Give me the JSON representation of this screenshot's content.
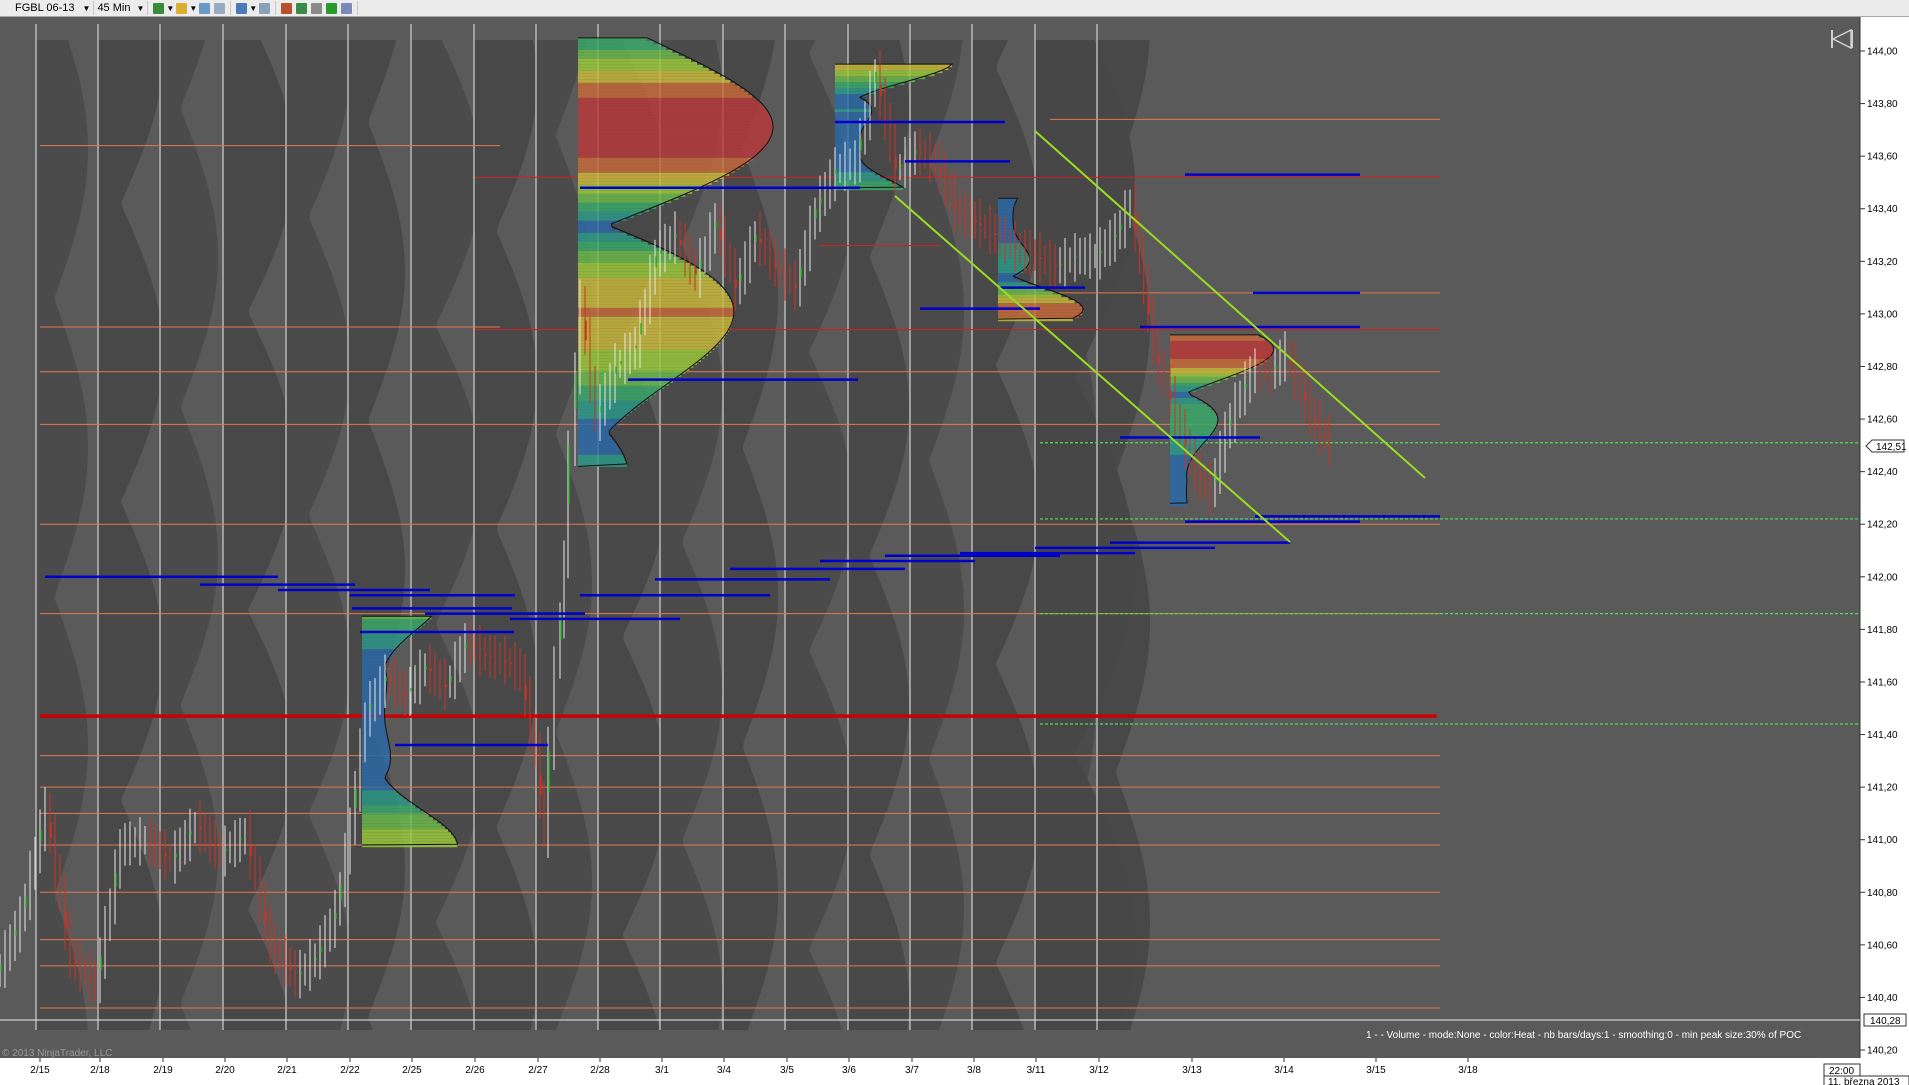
{
  "toolbar": {
    "instrument": "FGBL 06-13",
    "interval": "45 Min",
    "icons": [
      "bar-type-icon",
      "pencil-icon",
      "zoom-in-icon",
      "zoom-out-icon",
      "crosshair-icon",
      "magnifier-icon",
      "chart-properties-icon",
      "indicators-icon",
      "strategies-icon",
      "money-icon",
      "data-box-icon"
    ]
  },
  "chart_data": {
    "type": "candlestick",
    "ylim": [
      140.18,
      144.1
    ],
    "y_ticks": [
      "144,00",
      "143,80",
      "143,60",
      "143,40",
      "143,20",
      "143,00",
      "142,80",
      "142,60",
      "142,40",
      "142,20",
      "142,00",
      "141,80",
      "141,60",
      "141,40",
      "141,20",
      "141,00",
      "140,80",
      "140,60",
      "140,40",
      "140,20"
    ],
    "x_ticks": [
      "2/15",
      "2/18",
      "2/19",
      "2/20",
      "2/21",
      "2/22",
      "2/25",
      "2/26",
      "2/27",
      "2/28",
      "3/1",
      "3/4",
      "3/5",
      "3/6",
      "3/7",
      "3/8",
      "3/11",
      "3/12",
      "3/13",
      "3/14",
      "3/15",
      "3/18"
    ],
    "last_price": "142,51",
    "crosshair_price": "140,28",
    "time_label": "22:00",
    "date_label": "11. března 2013",
    "copyright": "© 2013 NinjaTrader, LLC",
    "indicator_label": "1 -   - Volume - mode:None  - color:Heat - nb bars/days:1 - smoothing:0 - min peak size:30% of POC",
    "colors": {
      "background": "#5a5a5a",
      "up_bar": "#22aa22",
      "down_bar": "#cc3322",
      "poc_line": "#cc0000",
      "value_area": "#0000cc",
      "trend_channel": "#99dd22"
    }
  }
}
